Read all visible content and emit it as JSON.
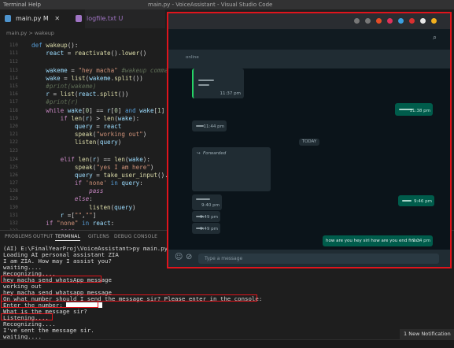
{
  "titlebar": {
    "menu": [
      "Terminal",
      "Help"
    ],
    "title": "main.py - VoiceAssistant - Visual Studio Code"
  },
  "tabs": [
    {
      "label": "main.py M",
      "color": "#4e94ce"
    },
    {
      "label": "logfile.txt U",
      "color": "#a074c4"
    }
  ],
  "breadcrumb": "main.py > wakeup",
  "editor": {
    "line_numbers": [
      "110",
      "111",
      "112",
      "113",
      "114",
      "115",
      "116",
      "117",
      "118",
      "119",
      "120",
      "121",
      "122",
      "123",
      "124",
      "125",
      "126",
      "127",
      "128",
      "129",
      "130",
      "131",
      "132",
      "133",
      "134",
      "135"
    ],
    "lines": [
      "def wakeup():",
      "    react = reactivate().lower()",
      "",
      "    wakeme = \"hey macha\" #wakeup command",
      "    wake = list(wakeme.split())",
      "    #print(wakeme)",
      "    r = list(react.split())",
      "    #print(r)",
      "    while wake[0] == r[0] and wake[1] == r[1]:",
      "        if len(r) > len(wake):",
      "            query = react",
      "            speak(\"working out\")",
      "            listen(query)",
      "",
      "        elif len(r) == len(wake):",
      "            speak(\"yes I am here\")",
      "            query = take_user_input().lower()",
      "            if 'none' in query:",
      "                pass",
      "            else:",
      "                listen(query)",
      "        r =[\"\",\"\"]",
      "    if \"none\" in react:",
      "        pass"
    ]
  },
  "panel_tabs": [
    "PROBLEMS",
    "OUTPUT",
    "TERMINAL",
    "GITLENS",
    "DEBUG CONSOLE"
  ],
  "terminal": {
    "lines": [
      "(AI) E:\\FinalYearProj\\VoiceAssistant>py main.py",
      "Loading AI personal assistant ZIA",
      "I am ZIA. How may I assist you?",
      "waiting....",
      "Recognizing....",
      "hey macha send whatsApp message",
      "working out",
      "hey macha send whatsapp message",
      "On what number should I send the message sir? Please enter in the console:",
      "Enter the number: ",
      "What is the message sir?",
      "Listening....",
      "Recognizing....",
      "I've sent the message sir.",
      "waiting...."
    ]
  },
  "notification": "1 New Notification",
  "whatsapp": {
    "header_label": "online",
    "date_chip": "TODAY",
    "forwarded": "Forwarded",
    "times": [
      "11:37 pm",
      "11:38 pm",
      "11:44 pm",
      "9:40 pm",
      "9:46 pm",
      "9:49 pm",
      "9:49 pm",
      "9:49 pm"
    ],
    "last_message": "how are you hey siri how are you end finish",
    "last_time": "9:14 pm",
    "input_placeholder": "Type a message"
  }
}
